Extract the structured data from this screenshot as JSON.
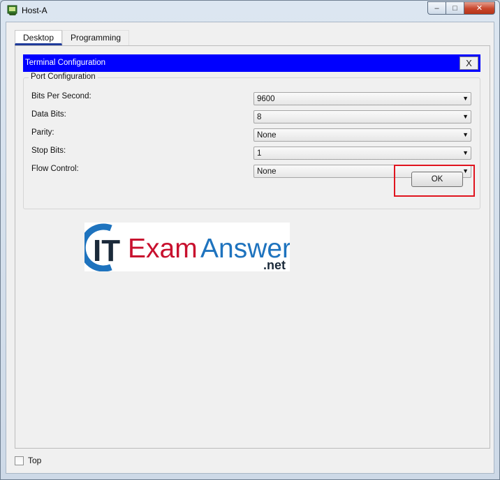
{
  "window": {
    "title": "Host-A",
    "caption": {
      "minimize": "–",
      "maximize": "□",
      "close": "✕"
    }
  },
  "tabs": [
    {
      "label": "Desktop",
      "active": true
    },
    {
      "label": "Programming",
      "active": false
    }
  ],
  "dialog": {
    "title": "Terminal Configuration",
    "close_label": "X",
    "header_color": "#0000ff",
    "group_title": "Port Configuration",
    "fields": [
      {
        "label": "Bits Per Second:",
        "value": "9600"
      },
      {
        "label": "Data Bits:",
        "value": "8"
      },
      {
        "label": "Parity:",
        "value": "None"
      },
      {
        "label": "Stop Bits:",
        "value": "1"
      },
      {
        "label": "Flow Control:",
        "value": "None"
      }
    ],
    "ok_label": "OK",
    "highlight_color": "#e0141e"
  },
  "logo": {
    "it": "IT",
    "brand1": "Exam",
    "brand2": "Answers",
    "domain": ".net",
    "colors": {
      "blue": "#1e73be",
      "red": "#c8102e",
      "dark": "#1b2a3a"
    }
  },
  "footer": {
    "top_label": "Top",
    "top_checked": false
  }
}
